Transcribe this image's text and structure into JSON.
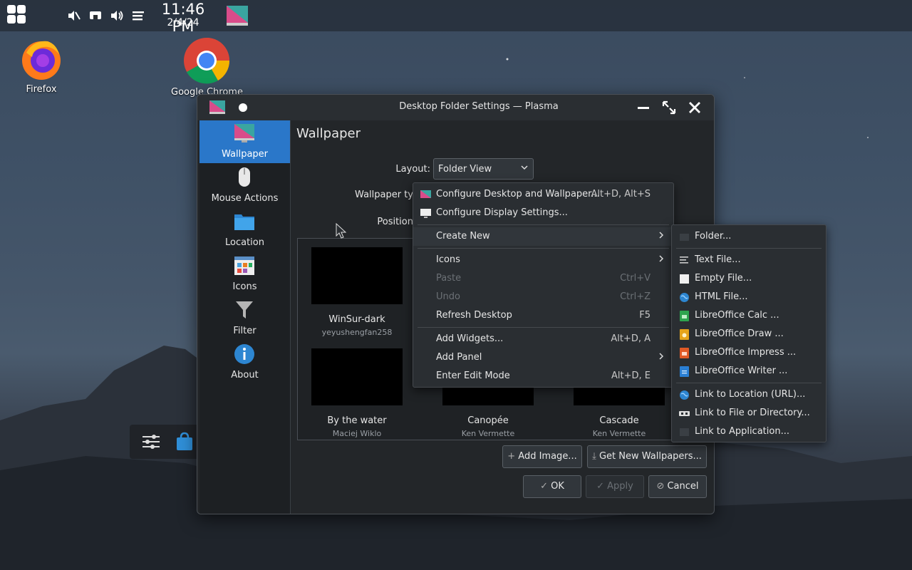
{
  "panel": {
    "time": "11:46 PM",
    "date": "2/4/24"
  },
  "desktop": {
    "icons": [
      {
        "label": "Firefox"
      },
      {
        "label": "Google Chrome"
      }
    ]
  },
  "window": {
    "title": "Desktop Folder Settings — Plasma",
    "sidebar": [
      {
        "label": "Wallpaper"
      },
      {
        "label": "Mouse Actions"
      },
      {
        "label": "Location"
      },
      {
        "label": "Icons"
      },
      {
        "label": "Filter"
      },
      {
        "label": "About"
      }
    ],
    "page_title": "Wallpaper",
    "layout_label": "Layout:",
    "layout_value": "Folder View",
    "wallpaper_type_label": "Wallpaper ty",
    "position_label": "Position",
    "wallpapers": [
      {
        "name": "WinSur-dark",
        "author": "yeyushengfan258"
      },
      {
        "name": "By the water",
        "author": "Maciej Wiklo"
      },
      {
        "name": "Canopée",
        "author": "Ken Vermette"
      },
      {
        "name": "Cascade",
        "author": "Ken Vermette"
      }
    ],
    "buttons": {
      "add_image": "Add Image...",
      "get_new": "Get New Wallpapers...",
      "ok": "OK",
      "apply": "Apply",
      "cancel": "Cancel"
    }
  },
  "context_menu": {
    "items": [
      {
        "label": "Configure Desktop and Wallpaper...",
        "shortcut": "Alt+D, Alt+S"
      },
      {
        "label": "Configure Display Settings...",
        "shortcut": ""
      },
      {
        "label": "Create New",
        "shortcut": ""
      },
      {
        "label": "Icons",
        "shortcut": ""
      },
      {
        "label": "Paste",
        "shortcut": "Ctrl+V"
      },
      {
        "label": "Undo",
        "shortcut": "Ctrl+Z"
      },
      {
        "label": "Refresh Desktop",
        "shortcut": "F5"
      },
      {
        "label": "Add Widgets...",
        "shortcut": "Alt+D, A"
      },
      {
        "label": "Add Panel",
        "shortcut": ""
      },
      {
        "label": "Enter Edit Mode",
        "shortcut": "Alt+D, E"
      }
    ]
  },
  "submenu": {
    "items": [
      {
        "label": "Folder..."
      },
      {
        "label": "Text File..."
      },
      {
        "label": "Empty File..."
      },
      {
        "label": "HTML File..."
      },
      {
        "label": "LibreOffice Calc ..."
      },
      {
        "label": "LibreOffice Draw ..."
      },
      {
        "label": "LibreOffice Impress ..."
      },
      {
        "label": "LibreOffice Writer ..."
      },
      {
        "label": "Link to Location (URL)..."
      },
      {
        "label": "Link to File or Directory..."
      },
      {
        "label": "Link to Application..."
      }
    ]
  },
  "colors": {
    "accent": "#2a77c9",
    "window_bg": "#232629",
    "menu_bg": "#2a2e32"
  }
}
